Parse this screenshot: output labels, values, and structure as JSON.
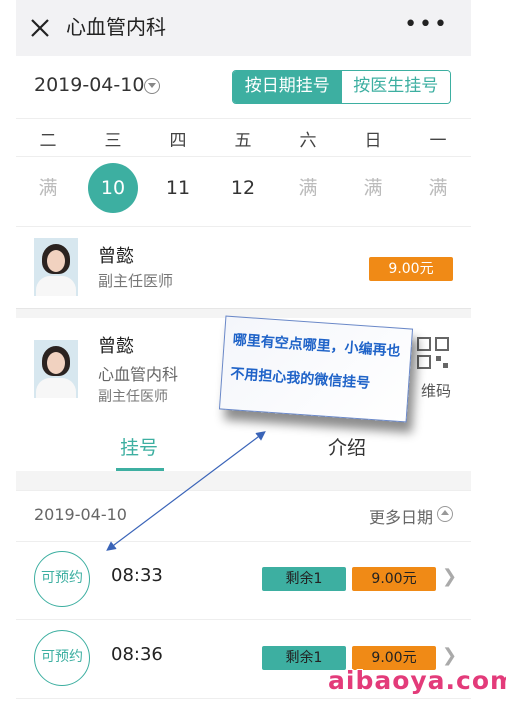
{
  "header": {
    "title": "心血管内科",
    "more": "•••"
  },
  "date_bar": {
    "current_date": "2019-04-10",
    "mode_tabs": [
      {
        "label": "按日期挂号",
        "active": true
      },
      {
        "label": "按医生挂号",
        "active": false
      }
    ]
  },
  "calendar": {
    "weekdays": [
      "二",
      "三",
      "四",
      "五",
      "六",
      "日",
      "一"
    ],
    "days": [
      "满",
      "10",
      "11",
      "12",
      "满",
      "满",
      "满"
    ],
    "selected_index": 1
  },
  "doctor_list": [
    {
      "name": "曾懿",
      "title": "副主任医师",
      "price": "9.00元"
    }
  ],
  "doctor_card": {
    "name": "曾懿",
    "dept": "心血管内科",
    "title": "副主任医师",
    "qr_label": "维码"
  },
  "tabs": [
    {
      "label": "挂号",
      "active": true
    },
    {
      "label": "介绍",
      "active": false
    }
  ],
  "schedule": {
    "date": "2019-04-10",
    "more_dates": "更多日期"
  },
  "slots": [
    {
      "status": "可预约",
      "time": "08:33",
      "remaining": "剩余1",
      "price": "9.00元"
    },
    {
      "status": "可预约",
      "time": "08:36",
      "remaining": "剩余1",
      "price": "9.00元"
    }
  ],
  "annotation": {
    "line1": "哪里有空点哪里，小编再也",
    "line2": "不用担心我的微信挂号"
  },
  "watermark": "aibaoya.com",
  "colors": {
    "accent": "#3dafa1",
    "price": "#f08a16",
    "annotation_text": "#1f63c8",
    "watermark": "#e33b7a"
  }
}
